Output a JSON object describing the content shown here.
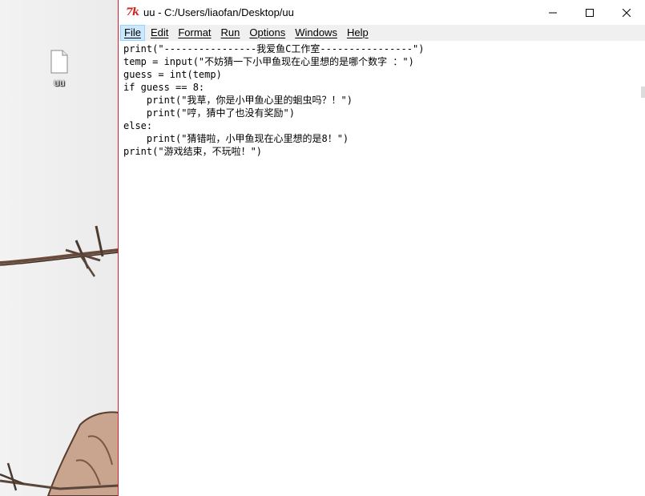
{
  "desktop": {
    "icon_label": "uu",
    "icon_name": "text-file-icon"
  },
  "window": {
    "title": "uu - C:/Users/liaofan/Desktop/uu",
    "app_icon_text": "7k",
    "accent_color": "#c1272d",
    "controls": [
      "minimize-icon",
      "maximize-icon",
      "close-icon"
    ]
  },
  "menu": {
    "items": [
      {
        "label": "File",
        "active": true
      },
      {
        "label": "Edit",
        "active": false
      },
      {
        "label": "Format",
        "active": false
      },
      {
        "label": "Run",
        "active": false
      },
      {
        "label": "Options",
        "active": false
      },
      {
        "label": "Windows",
        "active": false
      },
      {
        "label": "Help",
        "active": false
      }
    ]
  },
  "editor": {
    "lines": [
      "print(\"----------------我爱鱼C工作室----------------\")",
      "temp = input(\"不妨猜一下小甲鱼现在心里想的是哪个数字 ：\")",
      "guess = int(temp)",
      "if guess == 8:",
      "    print(\"我草，你是小甲鱼心里的蛔虫吗？！\")",
      "    print(\"哼，猜中了也没有奖励\")",
      "else:",
      "    print(\"猜错啦，小甲鱼现在心里想的是8！\")",
      "print(\"游戏结束，不玩啦！\")"
    ]
  }
}
